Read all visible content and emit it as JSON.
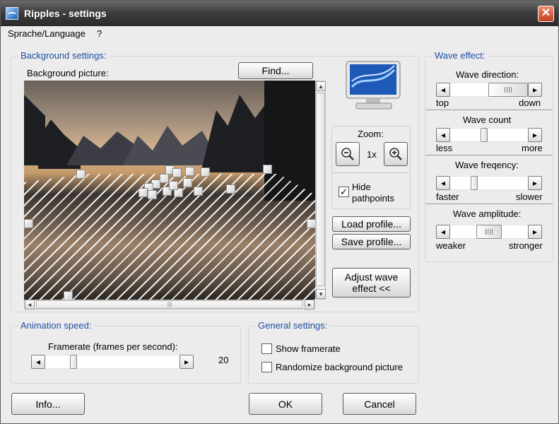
{
  "window": {
    "title": "Ripples - settings",
    "close_glyph": "✕"
  },
  "menu": {
    "items": [
      "Sprache/Language",
      "?"
    ]
  },
  "background": {
    "group_title": "Background settings:",
    "picture_label": "Background picture:",
    "find_label": "Find..."
  },
  "zoom": {
    "label": "Zoom:",
    "value": "1x",
    "out_icon": "zoom-out-icon",
    "in_icon": "zoom-in-icon"
  },
  "hide_pathpoints": {
    "line1": "Hide",
    "line2": "pathpoints",
    "checked": true,
    "mark": "✓"
  },
  "profile": {
    "load_label": "Load profile...",
    "save_label": "Save profile..."
  },
  "adjust": {
    "line1": "Adjust wave",
    "line2": "effect <<"
  },
  "wave": {
    "group_title": "Wave effect:",
    "direction": {
      "title": "Wave direction:",
      "left": "top",
      "right": "down",
      "level": 0.62
    },
    "count": {
      "title": "Wave count",
      "left": "less",
      "right": "more",
      "level": 0.43
    },
    "frequency": {
      "title": "Wave freqency:",
      "left": "faster",
      "right": "slower",
      "level": 0.3
    },
    "amplitude": {
      "title": "Wave amplitude:",
      "left": "weaker",
      "right": "stronger",
      "level": 0.38
    }
  },
  "animation": {
    "group_title": "Animation speed:",
    "framerate_label": "Framerate (frames per second):",
    "framerate_value": "20",
    "level": 0.27
  },
  "general": {
    "group_title": "General settings:",
    "show_framerate": "Show framerate",
    "randomize": "Randomize background picture"
  },
  "footer": {
    "info_label": "Info...",
    "ok_label": "OK",
    "cancel_label": "Cancel"
  },
  "glyphs": {
    "left": "◂",
    "right": "▸",
    "up": "▴",
    "down": "▾",
    "grip": "|||"
  },
  "colors": {
    "group_title": "#1d4fa3",
    "titlebar": "#3d3d3d",
    "close": "#c8411f"
  }
}
